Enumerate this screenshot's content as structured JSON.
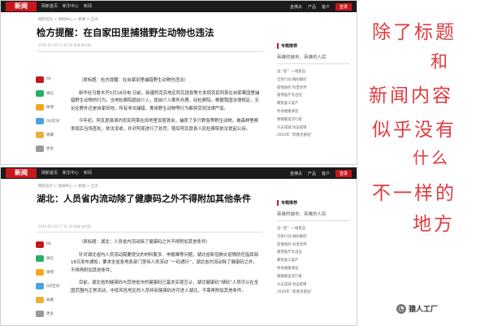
{
  "top": {
    "header": {
      "logo": "新闻",
      "nav": [
        "网新首页",
        "新华中心",
        "新闻"
      ],
      "right": [
        "金佛夫",
        "产品",
        "客户",
        "登录"
      ]
    },
    "breadcrumb": "网新首页 > 新闻中心 > 新闻 > 正文",
    "title": "检方提醒：在自家田里捕猎野生动物也违法",
    "meta": "2020-05-18 17:31:30  来源  新华网",
    "shares": [
      "66",
      "微信",
      "微博",
      "QQ空间",
      "收藏",
      "更多"
    ],
    "paragraphs": [
      "（原标题：检方提醒：在自家田里捕猎野生动物也违法）",
      "新华社乌鲁木齐5月18日电 日前，新疆阿克苏地区阿瓦提县警方发现农民阿某在自家果园里捕猎野生动物的行为，当地检察院提前介入，提前介入案件办理。经检察院，根据我国法律规定，无论在野外还是自家田地，所有非法捕猎，食用野生动物等行为都将受到法律严惩。",
      "今年初，阿瓦提县境内农民阿某在田地里设置铁夹，捕获了多只野兔等野生动物，被森林警察发现后当场查处，依法没收，并对阿某进行了处罚。随后阿瓦提县人民检察院依法提起公诉。"
    ],
    "sidebar": {
      "title": "专题推荐",
      "topic": "英雄的城市、英雄的人民",
      "items": [
        "战 “疫”· 一线直击",
        "全民行动 群防群控",
        "疫情防控 科普宣传",
        "援鄂医疗队出征",
        "聚焦复工复产",
        "各地驰援湖北",
        "致敬最美逆行者",
        "众志成城 抗击疫情",
        "2020年 “新春走基层”"
      ]
    }
  },
  "bottom": {
    "header": {
      "logo": "新闻",
      "nav": [
        "网新首页",
        "新华中心",
        "新闻"
      ],
      "right": [
        "金佛夫",
        "产品",
        "客户",
        "登录"
      ]
    },
    "breadcrumb": "网新首页 > 新闻中心 > 新闻 > 正文",
    "title": "湖北：人员省内流动除了健康码之外不得附加其他条件",
    "meta": "2020-05-18 17:31:30  来源  新华网",
    "shares": [
      "66",
      "微信",
      "微博",
      "QQ空间",
      "收藏",
      "更多"
    ],
    "paragraphs": [
      "（原标题：湖北：人员省内流动除了健康码之外不得附加其他条件）",
      "针对湖北省内人员流动需要提交的材料繁多、申报难等问题，湖北省新冠肺炎疫情防控指挥部18日发布通知，要求全省各地各部门坚持人员流动 “一码通行”，湖北省内流动除了健康码之外，不得再附加其他条件。",
      "目前，湖北省的健康码与其他省市的健康码已基本实现互认，湖北健康码“绿码”人员可以在全国范围内正常流动，中低风险地区的人员持有健康码亦可进入湖北，不需再附加其他条件。"
    ],
    "sidebar": {
      "title": "专题推荐",
      "topic": "英雄的城市、英雄的人民",
      "items": [
        "战 “疫”· 一线直击",
        "全民行动 群防群控",
        "疫情防控 科普宣传",
        "援鄂医疗队出征",
        "聚焦复工复产",
        "各地驰援湖北",
        "致敬最美逆行者",
        "众志成城 抗击疫情",
        "2020年 “新春走基层”"
      ]
    }
  },
  "annotation": {
    "lines": [
      "除了标题",
      "和",
      "新闻内容",
      "似乎没有",
      "什么",
      "不一样的",
      "地方"
    ]
  },
  "watermark": {
    "text": "猿人工厂"
  },
  "colors": {
    "brand_red": "#c8161d",
    "annotation_red": "#e03a3f",
    "share_icons": [
      "#c8161d",
      "#2aae67",
      "#f5a623",
      "#4aa3df",
      "#e8b23a",
      "#999999"
    ]
  }
}
